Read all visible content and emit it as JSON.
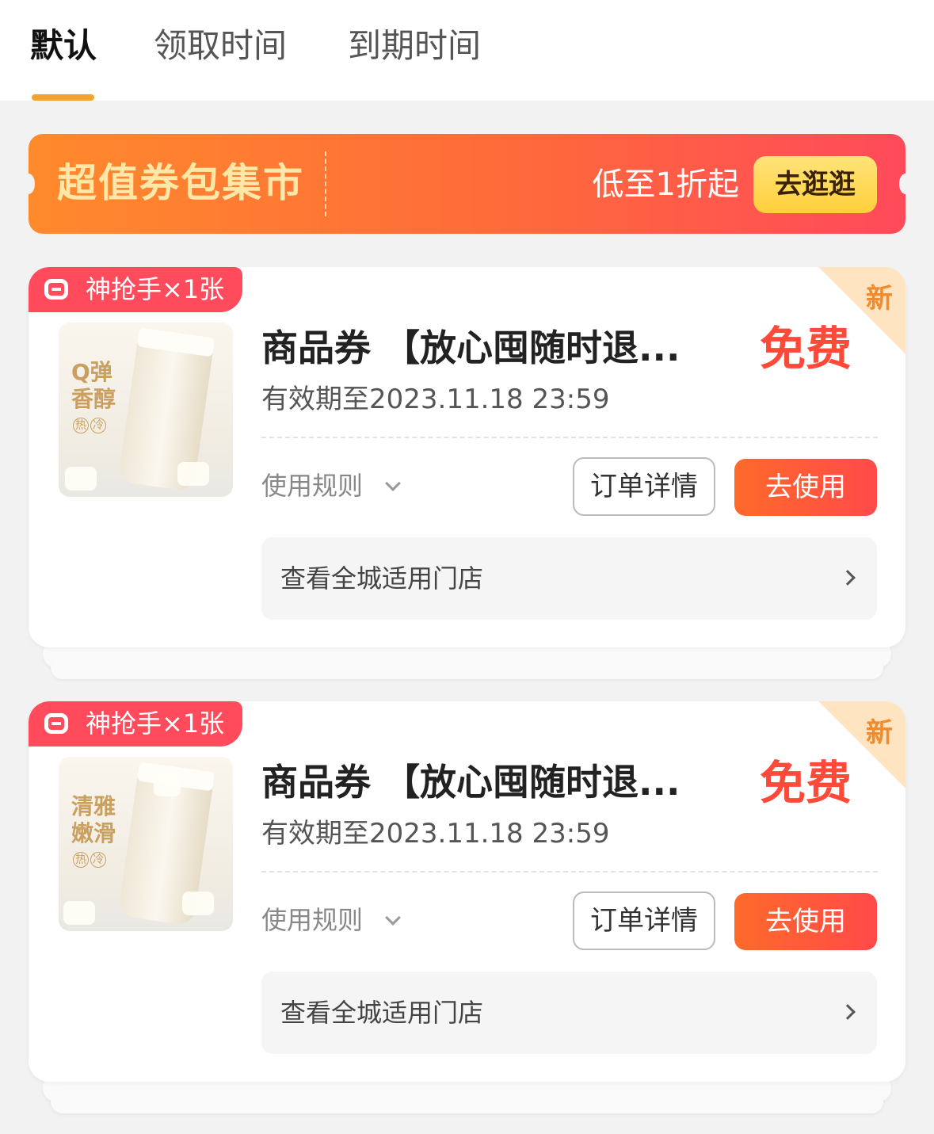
{
  "tabs": [
    {
      "label": "默认",
      "active": true
    },
    {
      "label": "领取时间",
      "active": false
    },
    {
      "label": "到期时间",
      "active": false
    }
  ],
  "banner": {
    "title": "超值券包集市",
    "subtitle": "低至1折起",
    "button_label": "去逛逛"
  },
  "coupons": [
    {
      "badge": "神抢手×1张",
      "new_label": "新",
      "thumb_label": "Q弹香醇",
      "thumb_tags": [
        "热",
        "冷"
      ],
      "title": "商品券 【放心囤随时退...",
      "price": "免费",
      "expiry": "有效期至2023.11.18 23:59",
      "rules_label": "使用规则",
      "detail_button": "订单详情",
      "use_button": "去使用",
      "stores_label": "查看全城适用门店"
    },
    {
      "badge": "神抢手×1张",
      "new_label": "新",
      "thumb_label": "清雅嫩滑",
      "thumb_tags": [
        "热",
        "冷"
      ],
      "title": "商品券 【放心囤随时退...",
      "price": "免费",
      "expiry": "有效期至2023.11.18 23:59",
      "rules_label": "使用规则",
      "detail_button": "订单详情",
      "use_button": "去使用",
      "stores_label": "查看全城适用门店"
    }
  ],
  "colors": {
    "accent": "#f5a32c",
    "price": "#ff4a3a",
    "badge": "#ff4b5c",
    "primary_button": "#ff5a3a",
    "banner_button": "#ffd84a"
  }
}
